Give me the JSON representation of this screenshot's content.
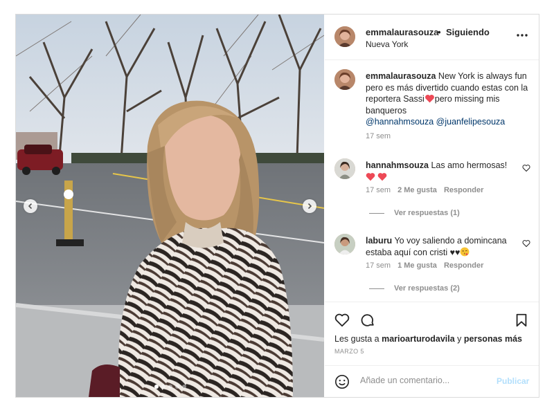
{
  "post": {
    "username": "emmalaurasouza",
    "separator": "•",
    "follow_status": "Siguiendo",
    "location": "Nueva York",
    "more_icon": "more-horizontal-icon"
  },
  "caption": {
    "username": "emmalaurasouza",
    "text_part1": " New York is always fun pero es más divertido cuando estas con la reportera Sassi",
    "text_part2": "pero missing mis banqueros",
    "mentions": [
      "@hannahmsouza",
      "@juanfelipesouza"
    ],
    "time": "17 sem"
  },
  "comments": [
    {
      "username": "hannahmsouza",
      "text": " Las amo hermosas!",
      "time": "17 sem",
      "likes": "2 Me gusta",
      "reply": "Responder",
      "view_replies": "Ver respuestas (1)"
    },
    {
      "username": "laburu",
      "text": " Yo voy saliendo a domincana estaba aquí con cristi ♥♥",
      "time": "17 sem",
      "likes": "1 Me gusta",
      "reply": "Responder",
      "view_replies": "Ver respuestas (2)"
    }
  ],
  "actions": {
    "likes_prefix": "Les gusta a ",
    "likes_user": "marioarturodavila",
    "likes_suffix": " y ",
    "likes_others": "personas más",
    "date": "MARZO 5"
  },
  "add_comment": {
    "placeholder": "Añade un comentario...",
    "post_label": "Publicar"
  },
  "carousel": {
    "slide_count": 5,
    "active_index": 0
  },
  "colors": {
    "accent_blue": "#b2dffc",
    "heart_red": "#ed4956",
    "mention_blue": "#00376b",
    "muted": "#8e8e8e"
  }
}
